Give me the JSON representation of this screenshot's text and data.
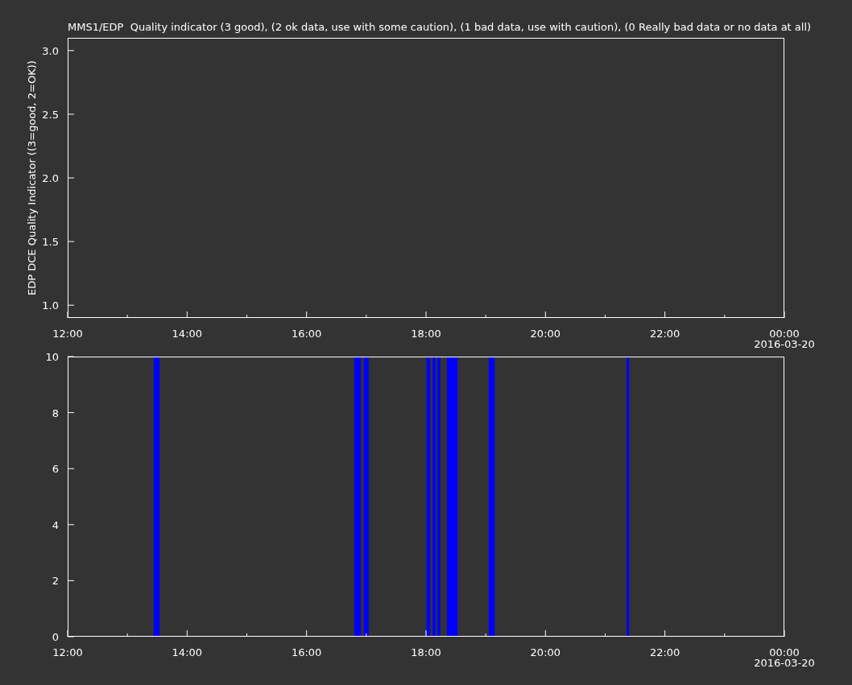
{
  "title": "MMS1/EDP  Quality indicator (3 good), (2 ok data, use with some caution), (1 bad data, use with caution), (0 Really bad data or no data at all)",
  "panels": [
    {
      "date_label": "2016-03-20",
      "chart_data": {
        "type": "line",
        "ylabel": "EDP DCE Quality Indicator ((3=good, 2=OK))",
        "xlim": [
          12,
          24
        ],
        "ylim": [
          0.9,
          3.1
        ],
        "xticks": [
          {
            "value": 12,
            "label": "12:00"
          },
          {
            "value": 14,
            "label": "14:00"
          },
          {
            "value": 16,
            "label": "16:00"
          },
          {
            "value": 18,
            "label": "18:00"
          },
          {
            "value": 20,
            "label": "20:00"
          },
          {
            "value": 22,
            "label": "22:00"
          },
          {
            "value": 24,
            "label": "00:00"
          }
        ],
        "yticks": [
          {
            "value": 1,
            "label": "1.0"
          },
          {
            "value": 1.5,
            "label": "1.5"
          },
          {
            "value": 2,
            "label": "2.0"
          },
          {
            "value": 2.5,
            "label": "2.5"
          },
          {
            "value": 3,
            "label": "3.0"
          }
        ]
      }
    },
    {
      "date_label": "2016-03-20",
      "chart_data": {
        "type": "area",
        "xlim": [
          12,
          24
        ],
        "ylim": [
          0,
          10
        ],
        "xticks": [
          {
            "value": 12,
            "label": "12:00"
          },
          {
            "value": 14,
            "label": "14:00"
          },
          {
            "value": 16,
            "label": "16:00"
          },
          {
            "value": 18,
            "label": "18:00"
          },
          {
            "value": 20,
            "label": "20:00"
          },
          {
            "value": 22,
            "label": "22:00"
          },
          {
            "value": 24,
            "label": "00:00"
          }
        ],
        "yticks": [
          0,
          2,
          4,
          6,
          8,
          10
        ],
        "x": [
          13.44,
          13.44,
          13.54,
          13.54,
          16.8,
          16.8,
          16.91,
          16.91,
          16.96,
          16.96,
          17.04,
          17.04,
          18.01,
          18.01,
          18.07,
          18.07,
          18.11,
          18.11,
          18.16,
          18.16,
          18.19,
          18.19,
          18.24,
          18.24,
          18.35,
          18.35,
          18.53,
          18.53,
          19.05,
          19.05,
          19.15,
          19.15,
          21.36,
          21.36,
          21.4,
          21.4
        ],
        "series": [
          {
            "color": "#0000ff",
            "values": [
              0,
              10,
              10,
              0,
              0,
              10,
              10,
              0,
              0,
              10,
              10,
              0,
              0,
              10,
              10,
              0,
              0,
              10,
              10,
              0,
              0,
              10,
              10,
              0,
              0,
              10,
              10,
              0,
              0,
              10,
              10,
              0,
              0,
              10,
              10,
              0
            ]
          }
        ]
      }
    }
  ]
}
